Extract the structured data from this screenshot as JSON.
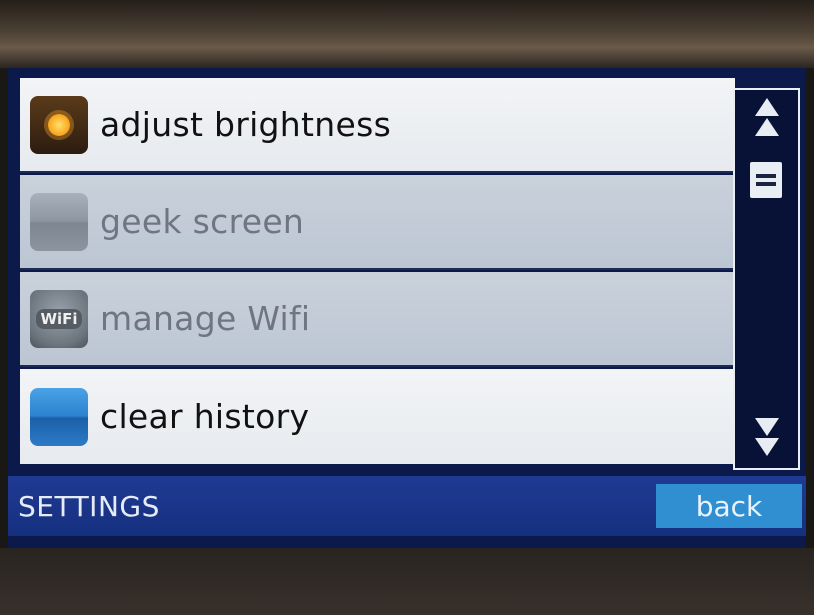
{
  "settings_list": {
    "items": [
      {
        "label": "adjust brightness",
        "icon": "sun-icon",
        "state": "enabled"
      },
      {
        "label": "geek screen",
        "icon": "square-icon",
        "state": "disabled"
      },
      {
        "label": "manage Wifi",
        "icon": "wifi-icon",
        "state": "disabled",
        "icon_text": "WiFi"
      },
      {
        "label": "clear history",
        "icon": "square-icon",
        "state": "enabled"
      }
    ]
  },
  "scrollbar": {
    "up_icon": "double-chevron-up-icon",
    "thumb_icon": "grip-icon",
    "down_icon": "double-chevron-down-icon"
  },
  "footer": {
    "title": "SETTINGS",
    "back_label": "back"
  },
  "colors": {
    "footer_bg": "#1e3a93",
    "back_button_bg": "#2f8fd0",
    "row_light": "#eef1f4",
    "row_dim": "#c4cdd8",
    "screen_bg": "#0b1a4a"
  }
}
